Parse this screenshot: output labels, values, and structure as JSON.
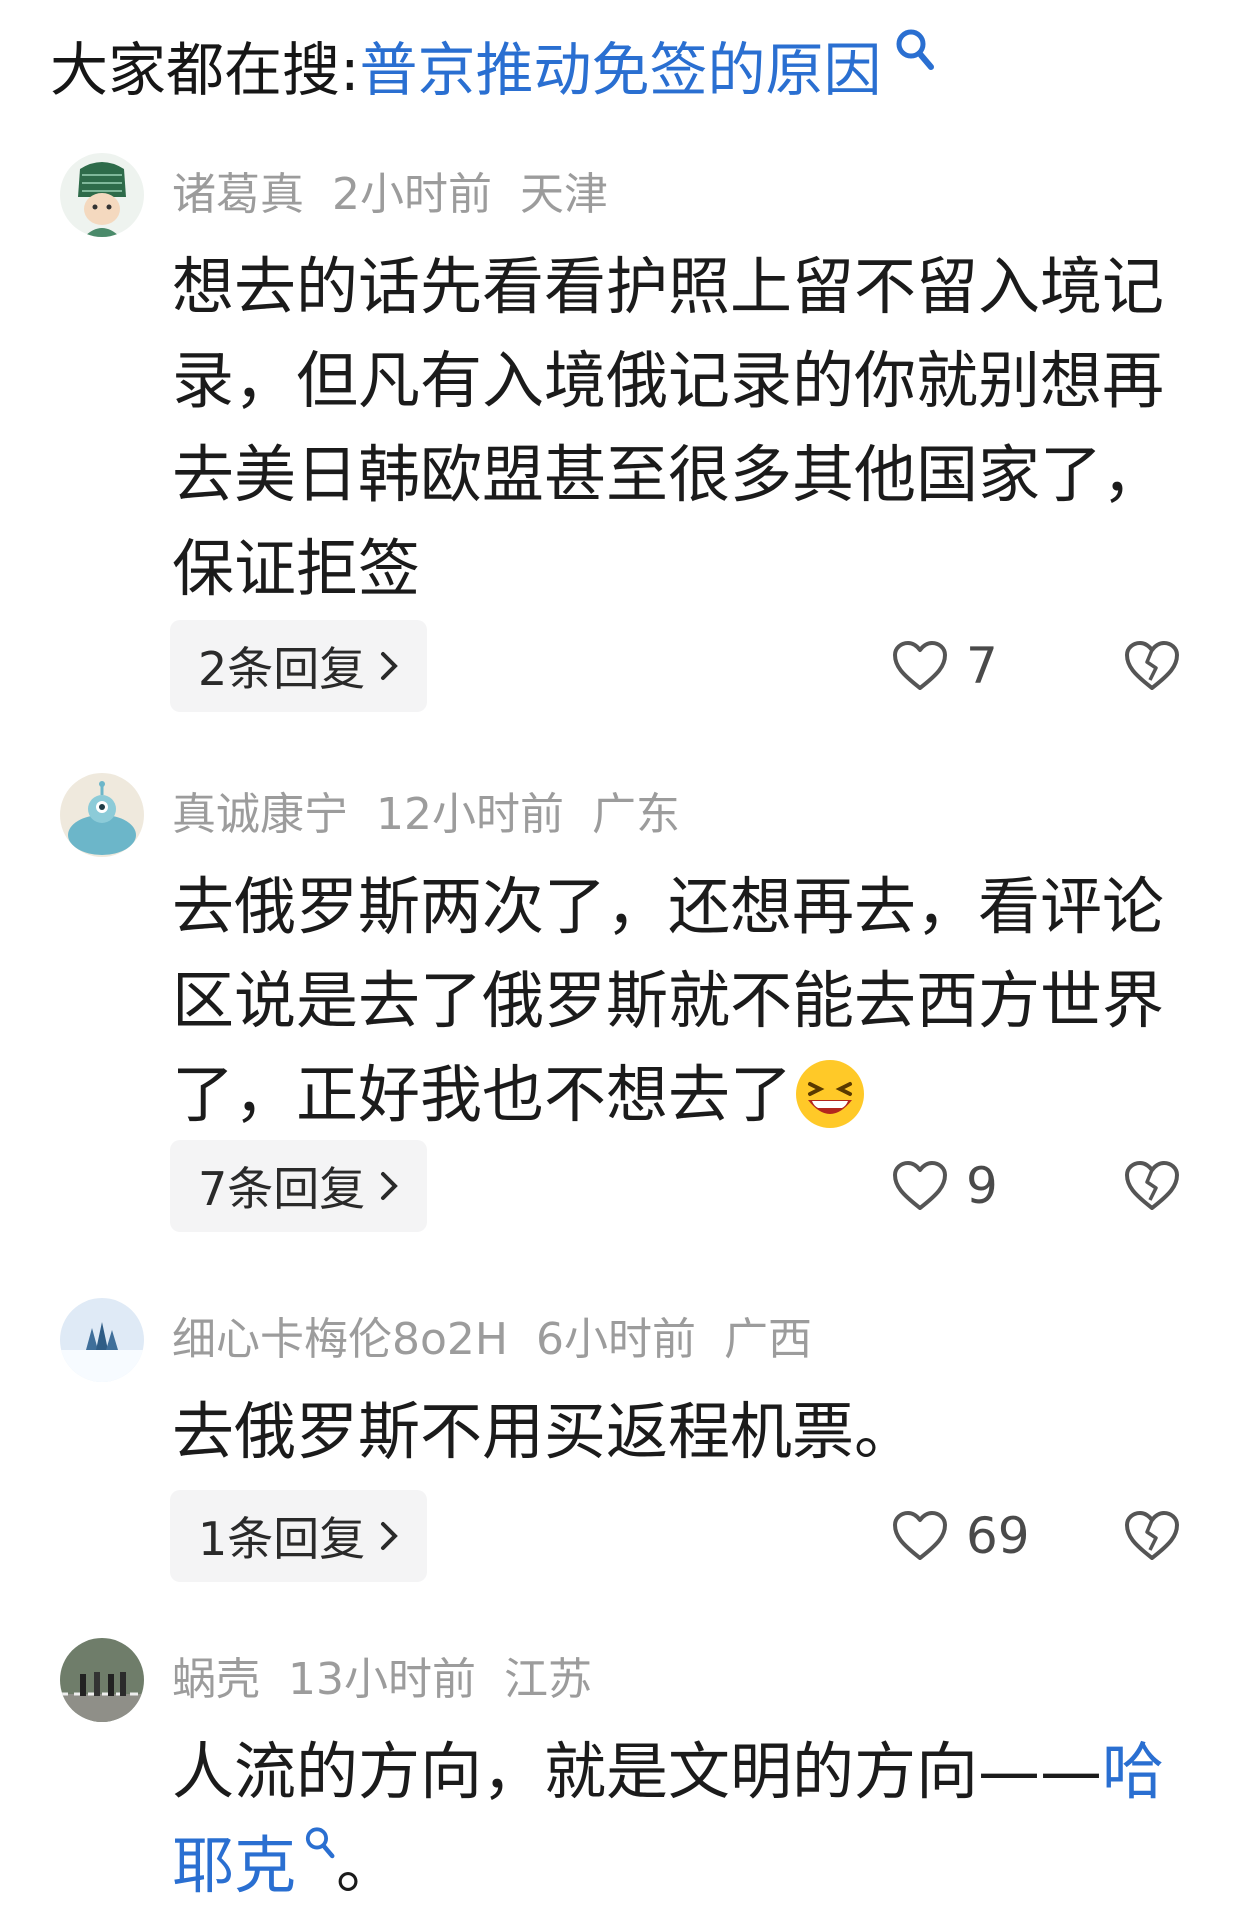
{
  "search": {
    "prefix": "大家都在搜:",
    "term": "普京推动免签的原因"
  },
  "comments": [
    {
      "username": "诸葛真",
      "time": "2小时前",
      "location": "天津",
      "text": "想去的话先看看护照上留不留入境记录，但凡有入境俄记录的你就别想再去美日韩欧盟甚至很多其他国家了，保证拒签",
      "replies": "2条回复",
      "likes": "7"
    },
    {
      "username": "真诚康宁",
      "time": "12小时前",
      "location": "广东",
      "text": "去俄罗斯两次了，还想再去，看评论区说是去了俄罗斯就不能去西方世界了，正好我也不想去了",
      "replies": "7条回复",
      "likes": "9"
    },
    {
      "username": "细心卡梅伦8o2H",
      "time": "6小时前",
      "location": "广西",
      "text": "去俄罗斯不用买返程机票。",
      "replies": "1条回复",
      "likes": "69"
    },
    {
      "username": "蜗壳",
      "time": "13小时前",
      "location": "江苏",
      "text_before": "人流的方向，就是文明的方向——",
      "link": "哈耶克",
      "text_after": "。"
    }
  ]
}
